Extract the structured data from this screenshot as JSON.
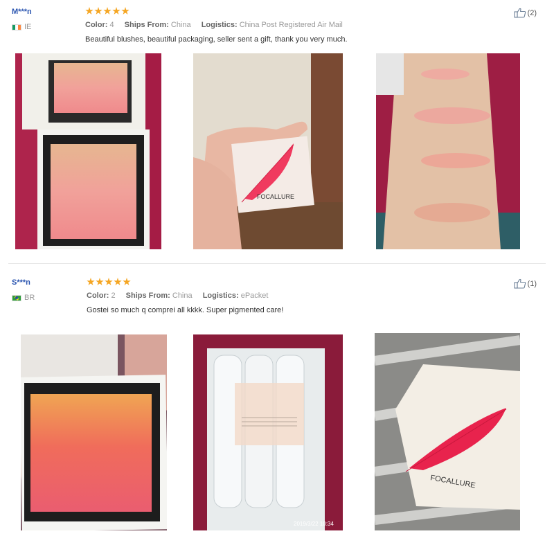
{
  "reviews": [
    {
      "user": "M***n",
      "country": "IE",
      "stars": 5,
      "color_label": "Color:",
      "color_value": "4",
      "ships_label": "Ships From:",
      "ships_value": "China",
      "logistics_label": "Logistics:",
      "logistics_value": "China Post Registered Air Mail",
      "text": "Beautiful blushes, beautiful packaging, seller sent a gift, thank you very much.",
      "helpful_count": "(2)",
      "photos": [
        {
          "subject": "open blush palette with mirror on red fabric"
        },
        {
          "subject": "hand holding FOCALLURE blush box",
          "brand": "FOCALLURE"
        },
        {
          "subject": "blush swatches on forearm"
        }
      ]
    },
    {
      "user": "S***n",
      "country": "BR",
      "stars": 5,
      "color_label": "Color:",
      "color_value": "2",
      "ships_label": "Ships From:",
      "ships_value": "China",
      "logistics_label": "Logistics:",
      "logistics_value": "ePacket",
      "text": "Gostei so much q comprei all kkkk. Super pigmented care!",
      "helpful_count": "(1)",
      "photos": [
        {
          "subject": "hand holding open blush compact"
        },
        {
          "subject": "product in bubble wrap packaging",
          "timestamp": "2019/3/22  10:34"
        },
        {
          "subject": "FOCALLURE box on white wooden table",
          "brand": "FOCALLURE"
        }
      ]
    }
  ],
  "colors": {
    "username": "#2b55b0",
    "star": "#f5a623",
    "meta": "#999999"
  }
}
